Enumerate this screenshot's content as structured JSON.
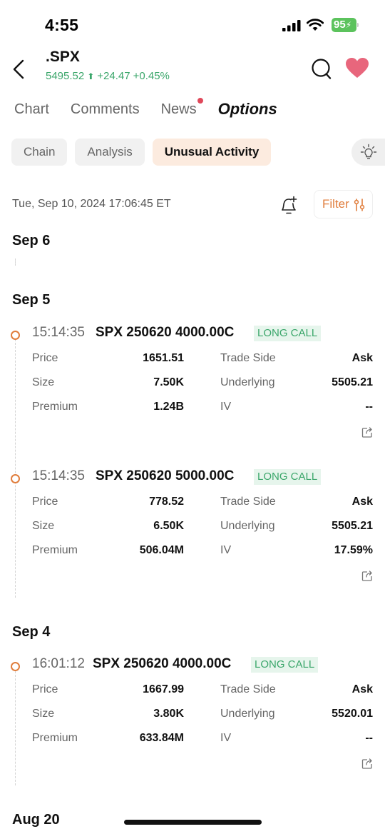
{
  "status_bar": {
    "time": "4:55",
    "battery": "95"
  },
  "header": {
    "ticker": ".SPX",
    "price": "5495.52",
    "change": "+24.47",
    "change_pct": "+0.45%",
    "colors": {
      "up": "#3aa66a",
      "heart": "#e8667c"
    }
  },
  "tabs": [
    {
      "label": "Chart"
    },
    {
      "label": "Comments"
    },
    {
      "label": "News"
    },
    {
      "label": "Options"
    }
  ],
  "subtabs": [
    {
      "label": "Chain"
    },
    {
      "label": "Analysis"
    },
    {
      "label": "Unusual Activity"
    }
  ],
  "toolbar": {
    "timestamp": "Tue, Sep 10, 2024 17:06:45 ET",
    "filter_label": "Filter"
  },
  "field_labels": {
    "price": "Price",
    "trade_side": "Trade Side",
    "size": "Size",
    "underlying": "Underlying",
    "premium": "Premium",
    "iv": "IV"
  },
  "days": [
    {
      "label": "Sep 6"
    },
    {
      "label": "Sep 5"
    },
    {
      "label": "Sep 4"
    },
    {
      "label": "Aug 20"
    }
  ],
  "trades": [
    {
      "time": "15:14:35",
      "contract": "SPX 250620 4000.00C",
      "badge": "LONG CALL",
      "price": "1651.51",
      "trade_side": "Ask",
      "size": "7.50K",
      "underlying": "5505.21",
      "premium": "1.24B",
      "iv": "--"
    },
    {
      "time": "15:14:35",
      "contract": "SPX 250620 5000.00C",
      "badge": "LONG CALL",
      "price": "778.52",
      "trade_side": "Ask",
      "size": "6.50K",
      "underlying": "5505.21",
      "premium": "506.04M",
      "iv": "17.59%"
    },
    {
      "time": "16:01:12",
      "contract": "SPX 250620 4000.00C",
      "badge": "LONG CALL",
      "price": "1667.99",
      "trade_side": "Ask",
      "size": "3.80K",
      "underlying": "5520.01",
      "premium": "633.84M",
      "iv": "--"
    }
  ]
}
